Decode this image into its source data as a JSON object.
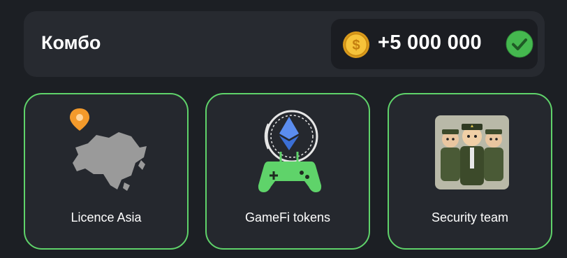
{
  "combo": {
    "title": "Комбо",
    "reward_amount": "+5 000 000",
    "coin_icon": "coin-icon",
    "status_icon": "check-circle-icon"
  },
  "cards": [
    {
      "label": "Licence Asia",
      "icon": "asia-map-icon"
    },
    {
      "label": "GameFi tokens",
      "icon": "gamepad-ethereum-icon"
    },
    {
      "label": "Security team",
      "icon": "security-team-image"
    }
  ],
  "colors": {
    "accent_green": "#5fd36a",
    "coin_gold": "#f3b72c",
    "background": "#1c1f24",
    "panel": "#272a30"
  }
}
